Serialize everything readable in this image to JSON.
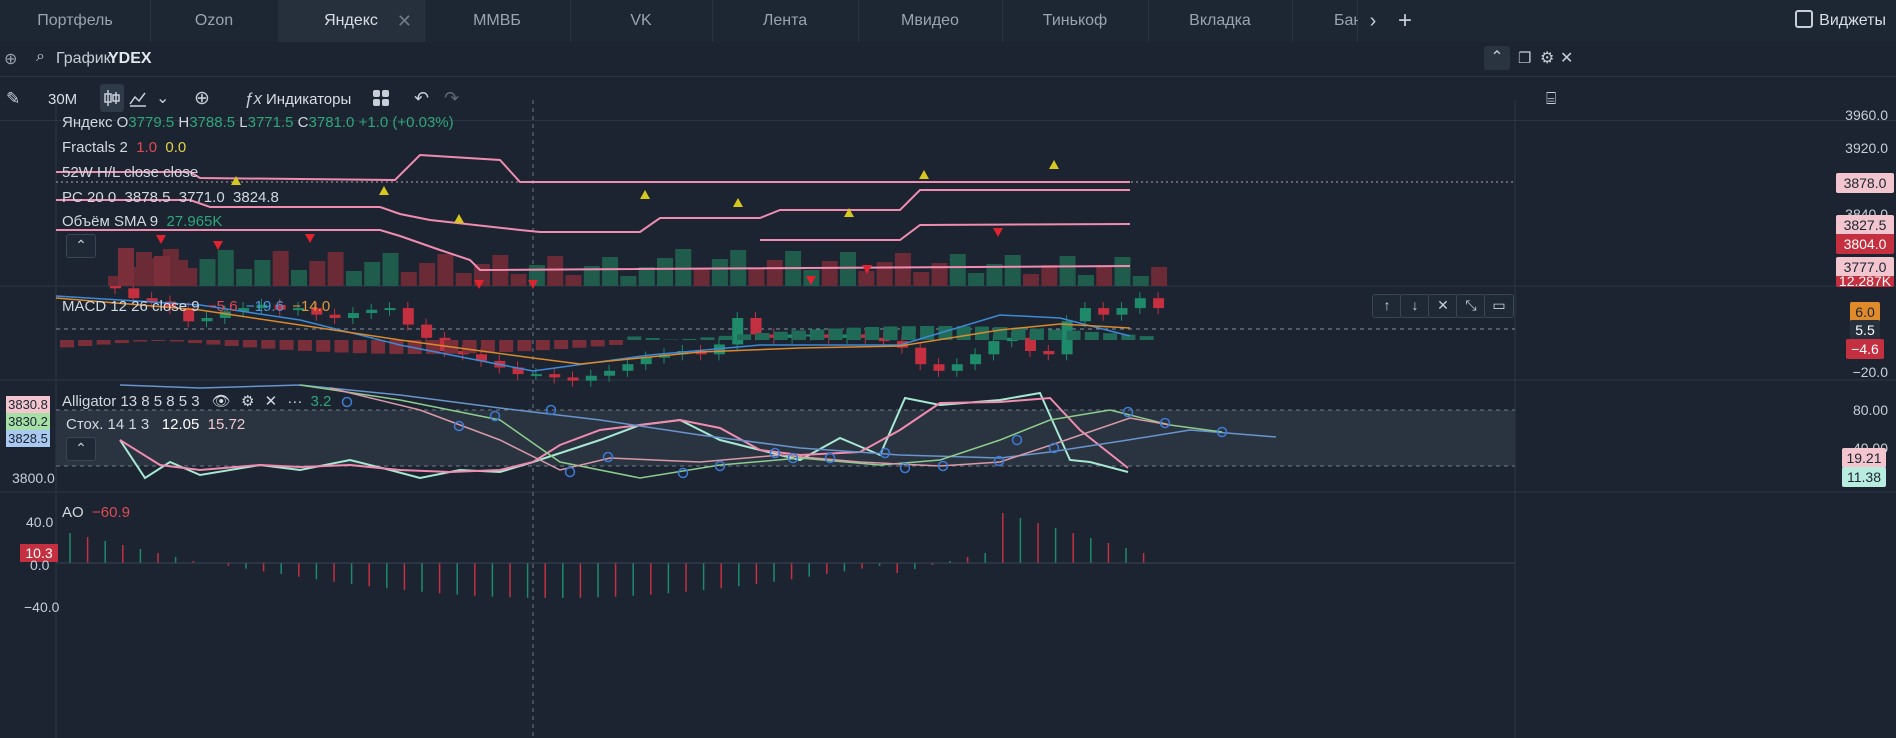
{
  "tabs": [
    "Портфель",
    "Ozon",
    "Яндекс",
    "ММВБ",
    "VK",
    "Лента",
    "Мвидео",
    "Тинькоф",
    "Вкладка",
    "Бан"
  ],
  "active_tab": "Яндекс",
  "widgets_label": "Виджеты",
  "search": {
    "label": "График",
    "ticker": "YDEX"
  },
  "toolbar": {
    "timeframe": "30M",
    "indicators_label": "Индикаторы"
  },
  "legends": {
    "main": {
      "name": "Яндекс",
      "o_label": "O",
      "o": "3779.5",
      "h_label": "H",
      "h": "3788.5",
      "l_label": "L",
      "l": "3771.5",
      "c_label": "C",
      "c": "3781.0",
      "chg": "+1.0 (+0.03%)"
    },
    "fractals": {
      "name": "Fractals 2",
      "v1": "1.0",
      "v2": "0.0"
    },
    "hl52": {
      "name": "52W H/L close close"
    },
    "pc": {
      "name": "PC 20 0",
      "v1": "3878.5",
      "v2": "3771.0",
      "v3": "3824.8"
    },
    "vol": {
      "name": "Объём SMA 9",
      "v": "27.965K"
    },
    "macd": {
      "name": "MACD 12 26 close 9",
      "v1": "−5.6",
      "v2": "−19.6",
      "v3": "−14.0"
    },
    "alligator": {
      "name": "Alligator 13 8 5 8 5 3",
      "v": "3.2"
    },
    "stoch": {
      "name": "Стох. 14 1 3",
      "v1": "12.05",
      "v2": "15.72"
    },
    "ao": {
      "name": "AO",
      "v": "−60.9"
    }
  },
  "price_axis": {
    "ticks": [
      "3960.0",
      "3920.0",
      "3840.0"
    ],
    "tags": [
      {
        "text": "3878.0",
        "bg": "#f3c6cf",
        "fg": "#1b2430"
      },
      {
        "text": "3827.5",
        "bg": "#f3c6cf",
        "fg": "#1b2430"
      },
      {
        "text": "3804.0",
        "bg": "#c4303f",
        "fg": "#ffffff"
      },
      {
        "text": "3777.0",
        "bg": "#f3c6cf",
        "fg": "#1b2430"
      },
      {
        "text": "12.287K",
        "bg": "#c4303f",
        "fg": "#ffffff"
      }
    ]
  },
  "macd_axis": {
    "tags": [
      {
        "text": "6.0",
        "bg": "#e08a2a",
        "fg": "#1b2430"
      },
      {
        "text": "5.5",
        "bg": "#26303d",
        "fg": "#ffffff"
      },
      {
        "text": "−4.6",
        "bg": "#c4303f",
        "fg": "#ffffff"
      }
    ],
    "tick": "−20.0"
  },
  "stoch_axis": {
    "ticks": [
      "80.00",
      "40.00"
    ],
    "tags": [
      {
        "text": "19.21",
        "bg": "#f3c6cf",
        "fg": "#1b2430"
      },
      {
        "text": "11.38",
        "bg": "#b7ecdf",
        "fg": "#1b2430"
      }
    ]
  },
  "alligator_left_tags": [
    {
      "text": "3830.8",
      "bg": "#f3c6cf"
    },
    {
      "text": "3830.2",
      "bg": "#a6e0a6"
    },
    {
      "text": "3828.5",
      "bg": "#a9c9f0"
    }
  ],
  "alligator_left_tick": "3800.0",
  "ao_axis": {
    "ticks": [
      "40.0",
      "0.0",
      "−40.0"
    ],
    "tag": "10.3"
  },
  "colors": {
    "up": "#1f8a6a",
    "down": "#c4303f",
    "pink": "#f08cb0",
    "bg": "#1b2430"
  }
}
